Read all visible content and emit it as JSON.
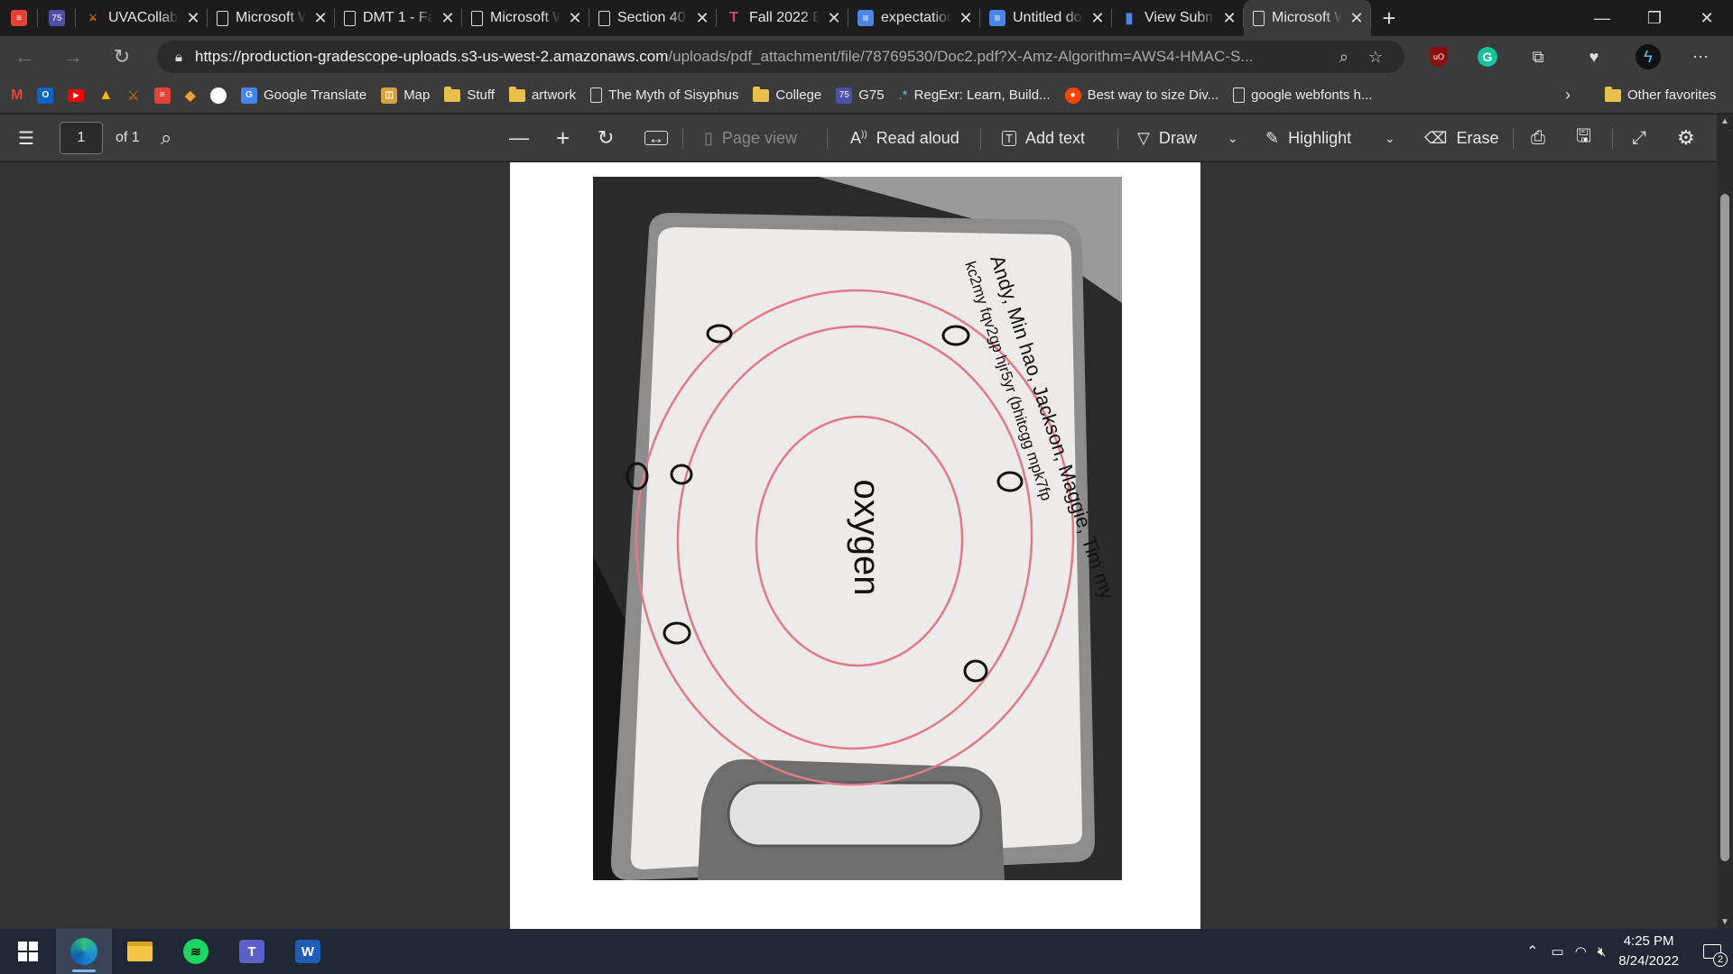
{
  "tabs": [
    {
      "title": "",
      "icon": "todoist-icon",
      "active": false,
      "icon_only": true
    },
    {
      "title": "",
      "icon": "g75-icon",
      "active": false,
      "icon_only": true
    },
    {
      "title": "UVACollab",
      "icon": "uva-icon",
      "active": false
    },
    {
      "title": "Microsoft W",
      "icon": "document-icon",
      "active": false
    },
    {
      "title": "DMT 1 - Fa",
      "icon": "document-icon",
      "active": false
    },
    {
      "title": "Microsoft W",
      "icon": "document-icon",
      "active": false
    },
    {
      "title": "Section 40",
      "icon": "document-icon",
      "active": false
    },
    {
      "title": "Fall 2022 E",
      "icon": "t-icon",
      "active": false
    },
    {
      "title": "expectation",
      "icon": "google-docs-icon",
      "active": false
    },
    {
      "title": "Untitled do",
      "icon": "google-docs-icon",
      "active": false
    },
    {
      "title": "View Subm",
      "icon": "chart-icon",
      "active": false
    },
    {
      "title": "Microsoft W",
      "icon": "document-icon",
      "active": true
    }
  ],
  "address": {
    "url_host": "https://production-gradescope-uploads.s3-us-west-2.amazonaws.com",
    "url_path": "/uploads/pdf_attachment/file/78769530/Doc2.pdf?X-Amz-Algorithm=AWS4-HMAC-S..."
  },
  "bookmarks": [
    {
      "label": "",
      "icon": "gmail-icon"
    },
    {
      "label": "",
      "icon": "outlook-icon"
    },
    {
      "label": "",
      "icon": "youtube-icon"
    },
    {
      "label": "",
      "icon": "google-drive-icon"
    },
    {
      "label": "",
      "icon": "uva-icon"
    },
    {
      "label": "",
      "icon": "todoist-icon"
    },
    {
      "label": "",
      "icon": "app-icon"
    },
    {
      "label": "",
      "icon": "github-icon"
    },
    {
      "label": "Google Translate",
      "icon": "google-translate-icon"
    },
    {
      "label": "Map",
      "icon": "map-icon"
    },
    {
      "label": "Stuff",
      "icon": "folder-icon"
    },
    {
      "label": "artwork",
      "icon": "folder-icon"
    },
    {
      "label": "The Myth of Sisyphus",
      "icon": "document-icon"
    },
    {
      "label": "College",
      "icon": "folder-icon"
    },
    {
      "label": "G75",
      "icon": "g75-icon"
    },
    {
      "label": "RegExr: Learn, Build...",
      "icon": "regexr-icon"
    },
    {
      "label": "Best way to size Div...",
      "icon": "reddit-icon"
    },
    {
      "label": "google webfonts h...",
      "icon": "document-icon"
    }
  ],
  "bookmarks_other": "Other favorites",
  "pdf_toolbar": {
    "page": "1",
    "page_of": "of 1",
    "page_view": "Page view",
    "read_aloud": "Read aloud",
    "add_text": "Add text",
    "draw": "Draw",
    "highlight": "Highlight",
    "erase": "Erase"
  },
  "photo": {
    "center_word": "oxygen",
    "handwriting_line1": "Andy, Min hao, Jackson, Maggie, Tim my",
    "handwriting_line2": "kc2my fqv2gp hjr5yr (bhitcgg mpk7fp"
  },
  "taskbar": {
    "apps": [
      "windows-start-icon",
      "edge-icon",
      "file-explorer-icon",
      "spotify-icon",
      "teams-icon",
      "word-icon"
    ],
    "time": "4:25 PM",
    "date": "8/24/2022",
    "notifications": "2"
  },
  "colors": {
    "tabstrip": "#1c1c1c",
    "toolbar": "#3b3b3b",
    "viewer_bg": "#333333",
    "taskbar": "#202735",
    "circle_marker": "#e07a86"
  }
}
